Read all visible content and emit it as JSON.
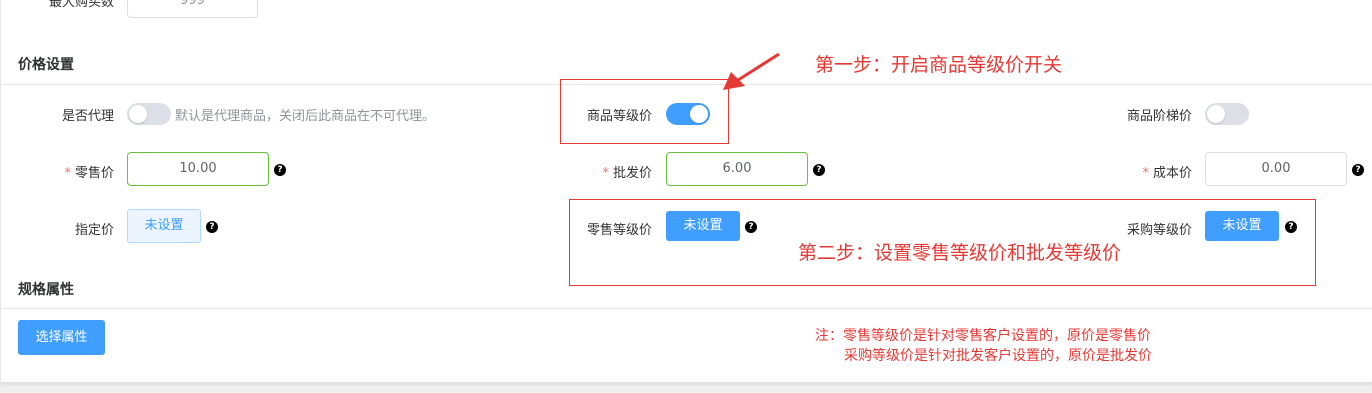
{
  "top_row": {
    "label": "最大购买数",
    "value": "999"
  },
  "price_section": {
    "title": "价格设置",
    "agent": {
      "label": "是否代理",
      "enabled": false,
      "hint": "默认是代理商品，关闭后此商品在不可代理。"
    },
    "level_price": {
      "label": "商品等级价",
      "enabled": true
    },
    "tier_price": {
      "label": "商品阶梯价",
      "enabled": false
    },
    "retail_price": {
      "required_mark": "*",
      "label": "零售价",
      "value": "10.00"
    },
    "wholesale_price": {
      "required_mark": "*",
      "label": "批发价",
      "value": "6.00"
    },
    "cost_price": {
      "required_mark": "*",
      "label": "成本价",
      "value": "0.00"
    },
    "designated_price": {
      "label": "指定价",
      "button": "未设置"
    },
    "retail_level_price": {
      "label": "零售等级价",
      "button": "未设置"
    },
    "purchase_level_price": {
      "label": "采购等级价",
      "button": "未设置"
    },
    "help_glyph": "?"
  },
  "spec_section": {
    "title": "规格属性",
    "select_button": "选择属性"
  },
  "annotations": {
    "step1": "第一步：开启商品等级价开关",
    "step2": "第二步：设置零售等级价和批发等级价",
    "note_line1": "注：零售等级价是针对零售客户设置的，原价是零售价",
    "note_line2": "采购等级价是针对批发客户设置的，原价是批发价",
    "color": "#e53935"
  },
  "colors": {
    "primary": "#409eff",
    "success_border": "#67c23a",
    "annotation_red": "#e53935"
  }
}
